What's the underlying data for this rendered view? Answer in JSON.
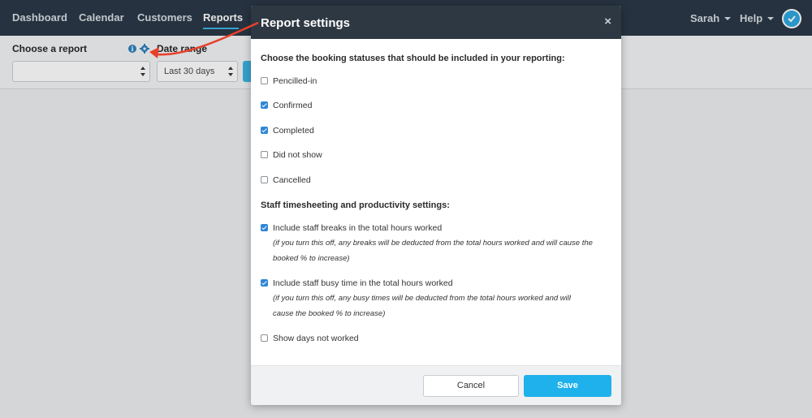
{
  "nav": {
    "items": [
      {
        "label": "Dashboard",
        "active": false
      },
      {
        "label": "Calendar",
        "active": false
      },
      {
        "label": "Customers",
        "active": false
      },
      {
        "label": "Reports",
        "active": true
      }
    ],
    "user": "Sarah",
    "help": "Help",
    "accent_color": "#38b2e3"
  },
  "filters": {
    "report_label": "Choose a report",
    "report_value": "",
    "date_range_label": "Date range",
    "date_range_value": "Last 30 days",
    "icons": [
      "info-icon",
      "gear-icon"
    ]
  },
  "modal": {
    "title": "Report settings",
    "close_icon": "×",
    "section1_title": "Choose the booking statuses that should be included in your reporting:",
    "statuses": [
      {
        "label": "Pencilled-in",
        "checked": false
      },
      {
        "label": "Confirmed",
        "checked": true
      },
      {
        "label": "Completed",
        "checked": true
      },
      {
        "label": "Did not show",
        "checked": false
      },
      {
        "label": "Cancelled",
        "checked": false
      }
    ],
    "section2_title": "Staff timesheeting and productivity settings:",
    "staff": [
      {
        "label": "Include staff breaks in the total hours worked",
        "checked": true,
        "hint_1": "(if you turn this off, any breaks will be deducted from the total hours worked and will cause the",
        "hint_2": "booked % to increase)"
      },
      {
        "label": "Include staff busy time in the total hours worked",
        "checked": true,
        "hint_1": "(if you turn this off, any busy times will be deducted from the total hours worked and will",
        "hint_2": "cause the booked % to increase)"
      },
      {
        "label": "Show days not worked",
        "checked": false
      }
    ],
    "cancel_label": "Cancel",
    "save_label": "Save",
    "save_color": "#1fb1ec"
  }
}
